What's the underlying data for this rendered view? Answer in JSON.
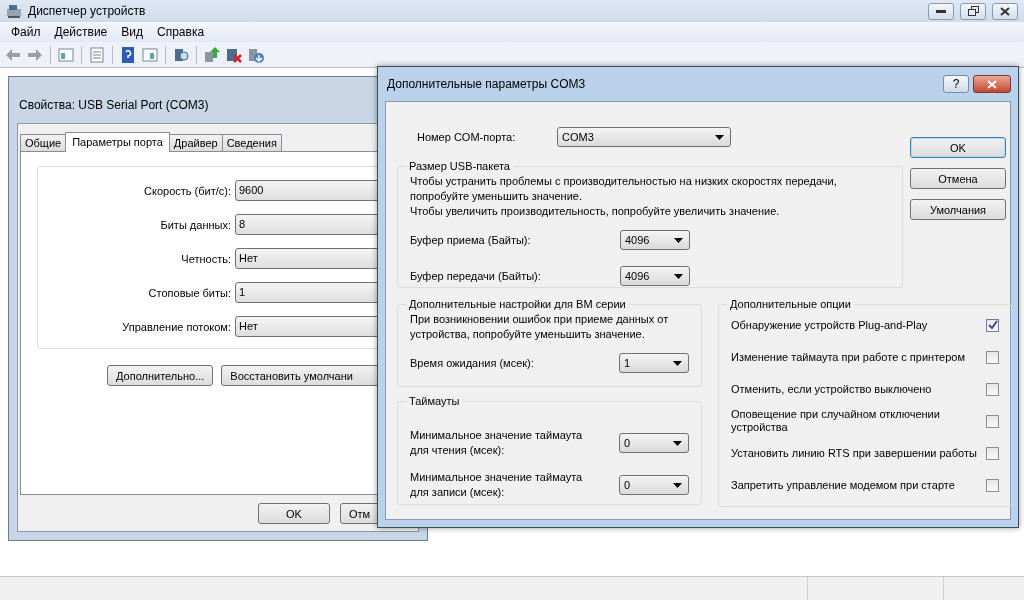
{
  "window": {
    "title": "Диспетчер устройств"
  },
  "menu": [
    "Файл",
    "Действие",
    "Вид",
    "Справка"
  ],
  "properties_dialog": {
    "title": "Свойства: USB Serial Port (COM3)",
    "tabs": [
      {
        "label": "Общие",
        "selected": false
      },
      {
        "label": "Параметры порта",
        "selected": true
      },
      {
        "label": "Драйвер",
        "selected": false
      },
      {
        "label": "Сведения",
        "selected": false
      }
    ],
    "fields": [
      {
        "label": "Скорость (бит/с):",
        "value": "9600"
      },
      {
        "label": "Биты данных:",
        "value": "8"
      },
      {
        "label": "Четность:",
        "value": "Нет"
      },
      {
        "label": "Стоповые биты:",
        "value": "1"
      },
      {
        "label": "Управление потоком:",
        "value": "Нет"
      }
    ],
    "buttons": [
      "Дополнительно...",
      "Восстановить умолчани"
    ],
    "footer_buttons": [
      "OK",
      "Отм"
    ]
  },
  "advanced_dialog": {
    "title": "Дополнительные параметры COM3",
    "help": "?",
    "com_port": {
      "label": "Номер COM-порта:",
      "value": "COM3"
    },
    "usb_packet": {
      "title": "Размер USB-пакета",
      "description": [
        "Чтобы устранить проблемы с производительностью на низких скоростях передачи, попробуйте уменьшить значение.",
        "Чтобы увеличить производительность, попробуйте увеличить значение."
      ],
      "fields": [
        {
          "label": "Буфер приема (Байты):",
          "value": "4096"
        },
        {
          "label": "Буфер передачи (Байты):",
          "value": "4096"
        }
      ]
    },
    "bm_settings": {
      "title": "Дополнительные настройки для BM серии",
      "description": "При возникновении ошибок при приеме данных от устройства, попробуйте уменьшить значение.",
      "fields": [
        {
          "label": "Время ожидания (мсек):",
          "value": "1"
        }
      ]
    },
    "timeouts": {
      "title": "Таймауты",
      "fields": [
        {
          "label": "Минимальное значение таймаута для чтения (мсек):",
          "value": "0"
        },
        {
          "label": "Минимальное значение таймаута для записи (мсек):",
          "value": "0"
        }
      ]
    },
    "options": {
      "title": "Дополнительные опции",
      "items": [
        {
          "label": "Обнаружение устройств Plug-and-Play",
          "checked": true
        },
        {
          "label": "Изменение таймаута при работе с принтером",
          "checked": false
        },
        {
          "label": "Отменить, если устройство выключено",
          "checked": false
        },
        {
          "label": "Оповещение при случайном отключении устройства",
          "checked": false
        },
        {
          "label": "Установить линию RTS при завершении работы",
          "checked": false
        },
        {
          "label": "Запретить управление модемом при старте",
          "checked": false
        }
      ]
    },
    "buttons": [
      {
        "label": "OK",
        "default": true
      },
      {
        "label": "Отмена",
        "default": false
      },
      {
        "label": "Умолчания",
        "default": false
      }
    ]
  }
}
